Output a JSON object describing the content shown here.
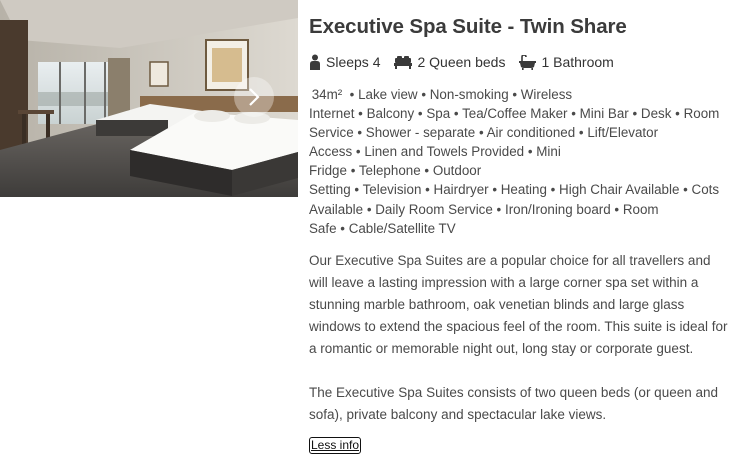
{
  "room": {
    "title": "Executive Spa Suite - Twin Share",
    "specs": {
      "sleeps": "Sleeps 4",
      "beds": "2 Queen beds",
      "bathrooms": "1 Bathroom"
    },
    "amenities": [
      "34m² ",
      "Lake view",
      "Non-smoking",
      "Wireless Internet",
      "Balcony",
      "Spa",
      "Tea/Coffee Maker",
      "Mini Bar",
      "Desk",
      "Room Service",
      "Shower - separate",
      "Air conditioned",
      "Lift/Elevator Access",
      "Linen and Towels Provided",
      "Mini Fridge",
      "Telephone",
      "Outdoor Setting",
      "Television",
      "Hairdryer",
      "Heating",
      "High Chair Available",
      "Cots Available",
      "Daily Room Service",
      "Iron/Ironing board",
      "Room Safe",
      "Cable/Satellite TV"
    ],
    "description": [
      "Our Executive Spa Suites are a popular choice for all travellers and will leave a lasting impression with a large corner spa set within a stunning marble bathroom, oak venetian blinds and large glass windows to extend the spacious feel of the room. This suite is ideal for a romantic or memorable night out, long stay or corporate guest.",
      "The Executive Spa Suites consists of two queen beds (or queen and sofa), private balcony and spectacular lake views."
    ],
    "less_info_label": "Less info"
  },
  "icons": {
    "sleeps": "person-icon",
    "beds": "bed-icon",
    "bathrooms": "bathtub-icon",
    "gallery_next": "chevron-right-icon"
  }
}
